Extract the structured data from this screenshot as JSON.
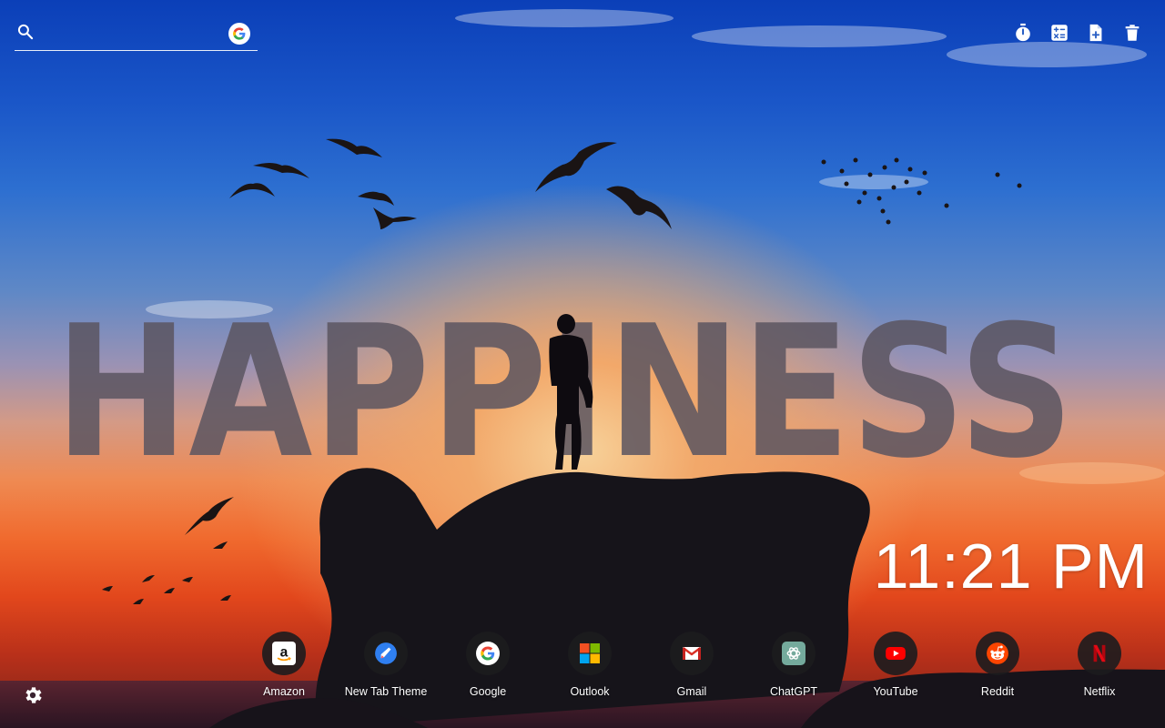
{
  "search": {
    "placeholder": "",
    "value": "",
    "engine_icon": "google-g-icon"
  },
  "toolbar": {
    "items": [
      {
        "name": "timer-button",
        "icon": "stopwatch-icon"
      },
      {
        "name": "calculator-button",
        "icon": "calculator-icon"
      },
      {
        "name": "new-note-button",
        "icon": "file-plus-icon"
      },
      {
        "name": "delete-button",
        "icon": "trash-icon"
      }
    ]
  },
  "wallpaper": {
    "headline": "HAPPINESS",
    "headline_color": "#5a5560"
  },
  "clock": {
    "time": "11:21 PM"
  },
  "shortcuts": [
    {
      "label": "Amazon",
      "icon": "amazon-icon"
    },
    {
      "label": "New Tab Theme",
      "icon": "new-tab-theme-icon"
    },
    {
      "label": "Google",
      "icon": "google-icon"
    },
    {
      "label": "Outlook",
      "icon": "microsoft-icon"
    },
    {
      "label": "Gmail",
      "icon": "gmail-icon"
    },
    {
      "label": "ChatGPT",
      "icon": "chatgpt-icon"
    },
    {
      "label": "YouTube",
      "icon": "youtube-icon"
    },
    {
      "label": "Reddit",
      "icon": "reddit-icon"
    },
    {
      "label": "Netflix",
      "icon": "netflix-icon"
    }
  ],
  "settings": {
    "icon": "gear-icon"
  },
  "colors": {
    "accent_white": "#ffffff",
    "tile_bg": "#1c1c1e",
    "sky_top": "#0b3fb8",
    "sunset": "#f06a2e"
  }
}
